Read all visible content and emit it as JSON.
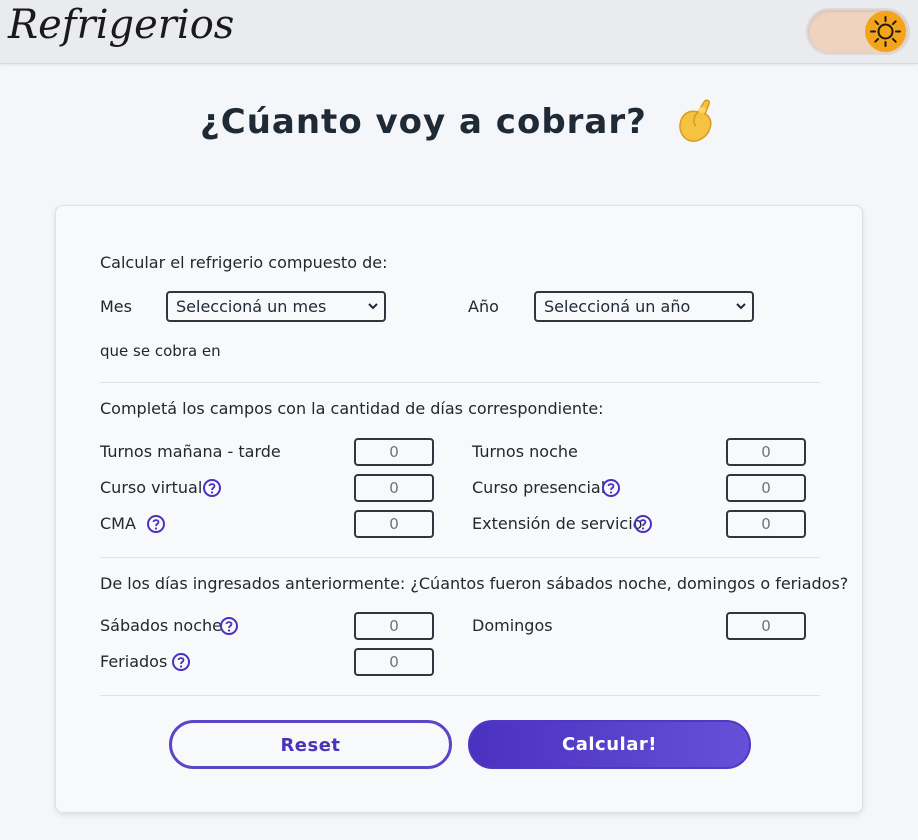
{
  "header": {
    "logo_text": "Refrigerios",
    "theme_toggle_icon": "sun-icon",
    "accent": "#f3a41b"
  },
  "page": {
    "title": "¿Cúanto voy a cobrar?",
    "title_icon": "pinched-fingers-emoji"
  },
  "form": {
    "intro_label": "Calcular el refrigerio compuesto de:",
    "month_label": "Mes",
    "month_select": "Seleccioná un mes",
    "year_label": "Año",
    "year_select": "Seleccioná un año",
    "charged_in_label": "que se cobra en",
    "days_section_title": "Completá los campos con la cantidad de días correspondiente:",
    "fields": {
      "morning_afternoon": {
        "label": "Turnos mañana - tarde",
        "placeholder": "0"
      },
      "night": {
        "label": "Turnos noche",
        "placeholder": "0"
      },
      "virtual_course": {
        "label": "Curso virtual",
        "placeholder": "0"
      },
      "in_person_course": {
        "label": "Curso presencial",
        "placeholder": "0"
      },
      "cma": {
        "label": "CMA",
        "placeholder": "0"
      },
      "service_extension": {
        "label": "Extensión de servicio",
        "placeholder": "0"
      }
    },
    "special_section_title": "De los días ingresados anteriormente: ¿Cúantos fueron sábados noche, domingos o feriados?",
    "special_fields": {
      "saturday_night": {
        "label": "Sábados noche",
        "placeholder": "0"
      },
      "sundays": {
        "label": "Domingos",
        "placeholder": "0"
      },
      "holidays": {
        "label": "Feriados",
        "placeholder": "0"
      }
    },
    "reset_label": "Reset",
    "calculate_label": "Calcular!",
    "primary_color": "#4a31bf"
  }
}
